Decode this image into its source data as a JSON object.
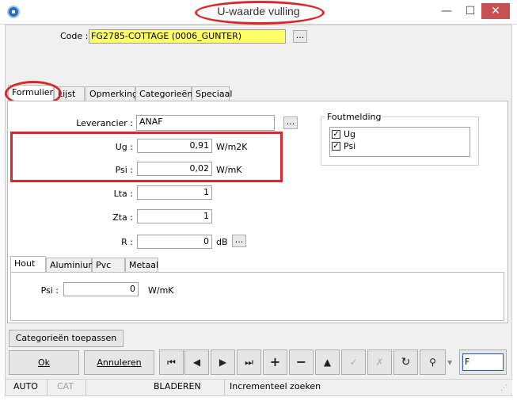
{
  "window": {
    "title": "U-waarde vulling",
    "minimize_glyph": "—",
    "maximize_glyph": "☐",
    "close_glyph": "✕"
  },
  "code": {
    "label": "Code :",
    "value": "FG2785-COTTAGE (0006_GUNTER)",
    "browse": "..."
  },
  "tabs": [
    {
      "label": "Formulier",
      "active": true
    },
    {
      "label": "Lijst"
    },
    {
      "label": "Opmerking"
    },
    {
      "label": "Categorieën"
    },
    {
      "label": "Speciaal"
    }
  ],
  "form": {
    "leverancier": {
      "label": "Leverancier :",
      "value": "ANAF",
      "browse": "..."
    },
    "ug": {
      "label": "Ug :",
      "value": "0,91",
      "unit": "W/m2K"
    },
    "psi": {
      "label": "Psi :",
      "value": "0,02",
      "unit": "W/mK"
    },
    "lta": {
      "label": "Lta :",
      "value": "1"
    },
    "zta": {
      "label": "Zta :",
      "value": "1"
    },
    "r": {
      "label": "R :",
      "value": "0",
      "unit": "dB",
      "browse": "..."
    }
  },
  "foutmelding": {
    "title": "Foutmelding",
    "items": [
      {
        "label": "Ug",
        "checked": true
      },
      {
        "label": "Psi",
        "checked": true
      }
    ]
  },
  "inner_tabs": [
    {
      "label": "Hout",
      "active": true
    },
    {
      "label": "Aluminium"
    },
    {
      "label": "Pvc"
    },
    {
      "label": "Metaal"
    }
  ],
  "hout": {
    "psi_label": "Psi :",
    "psi_value": "0",
    "psi_unit": "W/mK"
  },
  "buttons": {
    "categorieen_toepassen": "Categorieën toepassen",
    "ok": "Ok",
    "annuleren": "Annuleren"
  },
  "search": {
    "value": "F"
  },
  "status": {
    "auto": "AUTO",
    "cat": "CAT",
    "mode": "BLADEREN",
    "search_mode": "Incrementeel zoeken"
  },
  "colors": {
    "highlight": "#d9282a",
    "code_background": "#ffff66"
  }
}
